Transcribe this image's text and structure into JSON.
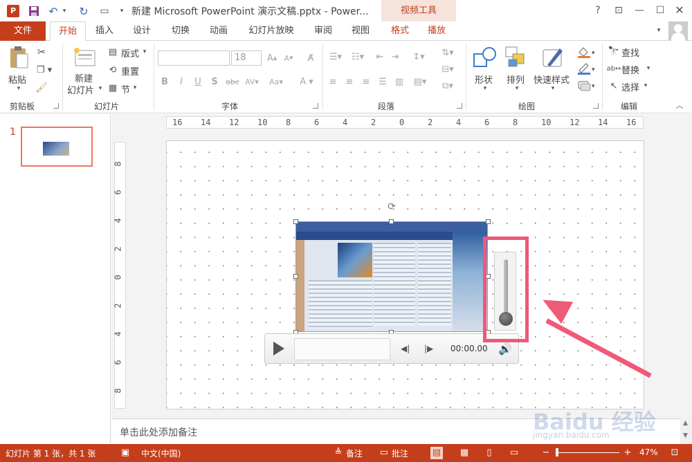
{
  "titlebar": {
    "title": "新建 Microsoft PowerPoint 演示文稿.pptx - Power...",
    "context_tab": "视频工具",
    "help": "?",
    "app_icon": "powerpoint-icon"
  },
  "tabs": [
    {
      "label": "文件"
    },
    {
      "label": "开始"
    },
    {
      "label": "插入"
    },
    {
      "label": "设计"
    },
    {
      "label": "切换"
    },
    {
      "label": "动画"
    },
    {
      "label": "幻灯片放映"
    },
    {
      "label": "审阅"
    },
    {
      "label": "视图"
    },
    {
      "label": "格式"
    },
    {
      "label": "播放"
    }
  ],
  "ribbon": {
    "clipboard": {
      "paste": "粘贴",
      "label": "剪贴板"
    },
    "slides": {
      "new_slide_line1": "新建",
      "new_slide_line2": "幻灯片",
      "layout": "版式",
      "reset": "重置",
      "section": "节",
      "label": "幻灯片"
    },
    "font": {
      "size": "18",
      "label": "字体"
    },
    "paragraph": {
      "label": "段落"
    },
    "drawing": {
      "shapes": "形状",
      "arrange": "排列",
      "quick_styles": "快速样式",
      "label": "绘图"
    },
    "editing": {
      "find": "查找",
      "replace": "替换",
      "select": "选择",
      "label": "编辑"
    }
  },
  "thumbnails": {
    "number": "1"
  },
  "ruler": {
    "h_ticks": [
      "16",
      "14",
      "12",
      "10",
      "8",
      "6",
      "4",
      "2",
      "0",
      "2",
      "4",
      "6",
      "8",
      "10",
      "12",
      "14",
      "16"
    ],
    "v_ticks": [
      "8",
      "6",
      "4",
      "2",
      "0",
      "2",
      "4",
      "6",
      "8"
    ]
  },
  "video": {
    "timecode": "00:00.00",
    "volume_level": 0
  },
  "notes": {
    "placeholder": "单击此处添加备注"
  },
  "statusbar": {
    "slide_info": "幻灯片 第 1 张，共 1 张",
    "language": "中文(中国)",
    "notes": "备注",
    "comments": "批注",
    "zoom": "47%"
  },
  "watermark": {
    "main": "Baidu 经验",
    "sub": "jingyan.baidu.com"
  },
  "colors": {
    "accent": "#c43e1c",
    "highlight": "#f0577a"
  }
}
